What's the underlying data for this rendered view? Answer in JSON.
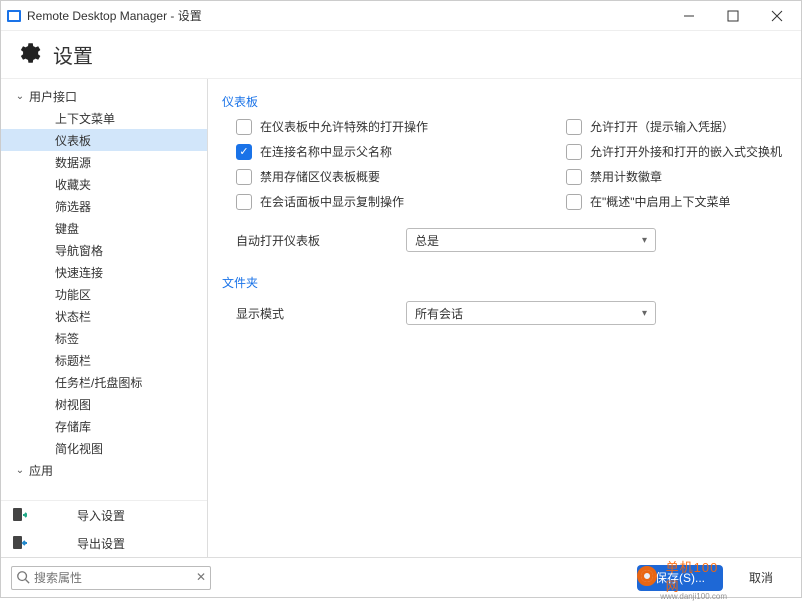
{
  "window": {
    "title": "Remote Desktop Manager - 设置"
  },
  "header": {
    "title": "设置"
  },
  "sidebar": {
    "nodes": [
      {
        "label": "用户接口",
        "level": 0,
        "expanded": true
      },
      {
        "label": "上下文菜单",
        "level": 1
      },
      {
        "label": "仪表板",
        "level": 1,
        "selected": true
      },
      {
        "label": "数据源",
        "level": 1
      },
      {
        "label": "收藏夹",
        "level": 1
      },
      {
        "label": "筛选器",
        "level": 1
      },
      {
        "label": "键盘",
        "level": 1
      },
      {
        "label": "导航窗格",
        "level": 1
      },
      {
        "label": "快速连接",
        "level": 1
      },
      {
        "label": "功能区",
        "level": 1
      },
      {
        "label": "状态栏",
        "level": 1
      },
      {
        "label": "标签",
        "level": 1
      },
      {
        "label": "标题栏",
        "level": 1
      },
      {
        "label": "任务栏/托盘图标",
        "level": 1
      },
      {
        "label": "树视图",
        "level": 1
      },
      {
        "label": "存储库",
        "level": 1
      },
      {
        "label": "简化视图",
        "level": 1
      },
      {
        "label": "应用",
        "level": 0,
        "expanded": true
      }
    ],
    "actions": {
      "import": "导入设置",
      "export": "导出设置"
    }
  },
  "panel": {
    "section1": "仪表板",
    "checks": [
      {
        "label": "在仪表板中允许特殊的打开操作",
        "checked": false
      },
      {
        "label": "允许打开（提示输入凭据）",
        "checked": false
      },
      {
        "label": "在连接名称中显示父名称",
        "checked": true
      },
      {
        "label": "允许打开外接和打开的嵌入式交换机",
        "checked": false
      },
      {
        "label": "禁用存储区仪表板概要",
        "checked": false
      },
      {
        "label": "禁用计数徽章",
        "checked": false
      },
      {
        "label": "在会话面板中显示复制操作",
        "checked": false
      },
      {
        "label": "在\"概述\"中启用上下文菜单",
        "checked": false
      }
    ],
    "autoOpen": {
      "label": "自动打开仪表板",
      "value": "总是"
    },
    "section2": "文件夹",
    "displayMode": {
      "label": "显示模式",
      "value": "所有会话"
    }
  },
  "footer": {
    "searchPlaceholder": "搜索属性",
    "save": "保存(S)...",
    "cancel": "取消"
  },
  "watermark": {
    "brand": "单机100网",
    "url": "www.danji100.com"
  }
}
